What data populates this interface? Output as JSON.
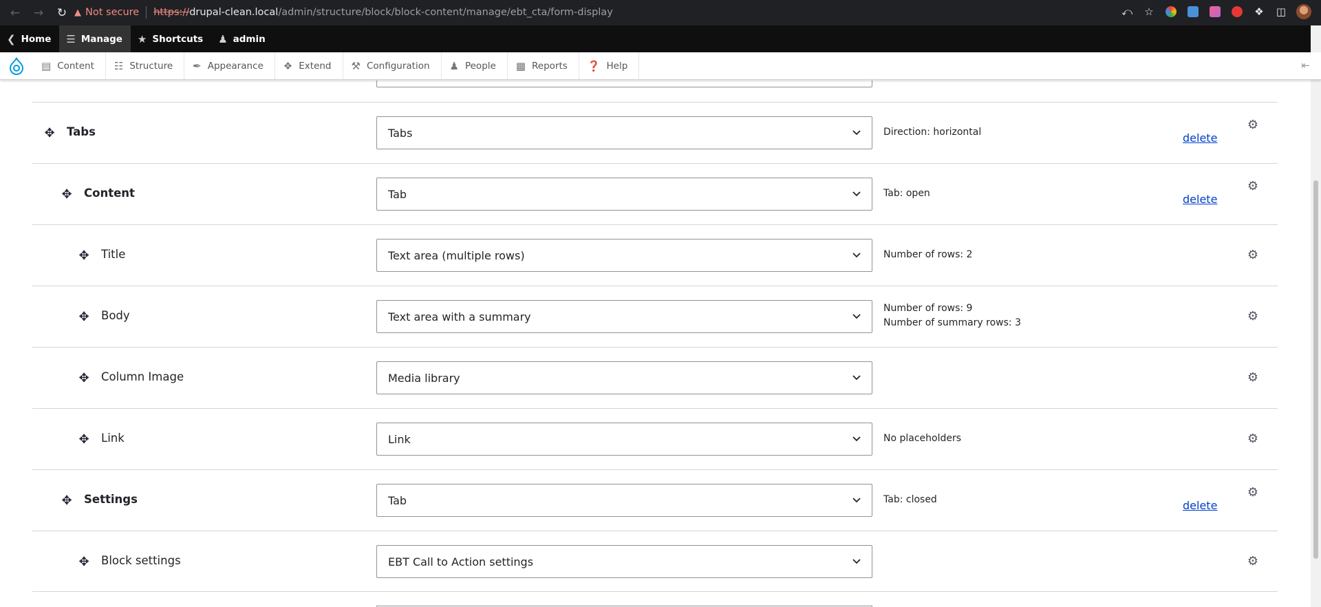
{
  "browser": {
    "not_secure": "Not secure",
    "url_scheme": "https://",
    "url_host": "drupal-clean.local",
    "url_path": "/admin/structure/block/block-content/manage/ebt_cta/form-display"
  },
  "toolbar": {
    "home": "Home",
    "manage": "Manage",
    "shortcuts": "Shortcuts",
    "user": "admin"
  },
  "menu": {
    "items": [
      {
        "label": "Content",
        "icon": "content-icon"
      },
      {
        "label": "Structure",
        "icon": "structure-icon"
      },
      {
        "label": "Appearance",
        "icon": "appearance-icon"
      },
      {
        "label": "Extend",
        "icon": "extend-icon"
      },
      {
        "label": "Configuration",
        "icon": "configuration-icon"
      },
      {
        "label": "People",
        "icon": "people-icon"
      },
      {
        "label": "Reports",
        "icon": "reports-icon"
      },
      {
        "label": "Help",
        "icon": "help-icon"
      }
    ]
  },
  "rows": [
    {
      "label": "Tabs",
      "widget": "Tabs",
      "summary": [
        "Direction: horizontal"
      ],
      "delete": "delete"
    },
    {
      "label": "Content",
      "widget": "Tab",
      "summary": [
        "Tab: open"
      ],
      "delete": "delete"
    },
    {
      "label": "Title",
      "widget": "Text area (multiple rows)",
      "summary": [
        "Number of rows: 2"
      ]
    },
    {
      "label": "Body",
      "widget": "Text area with a summary",
      "summary": [
        "Number of rows: 9",
        "Number of summary rows: 3"
      ]
    },
    {
      "label": "Column Image",
      "widget": "Media library",
      "summary": []
    },
    {
      "label": "Link",
      "widget": "Link",
      "summary": [
        "No placeholders"
      ]
    },
    {
      "label": "Settings",
      "widget": "Tab",
      "summary": [
        "Tab: closed"
      ],
      "delete": "delete"
    },
    {
      "label": "Block settings",
      "widget": "EBT Call to Action settings",
      "summary": []
    }
  ],
  "colors": {
    "link": "#003ecc",
    "toolbar_bg": "#0f0f0f",
    "not_secure": "#f28b82"
  }
}
